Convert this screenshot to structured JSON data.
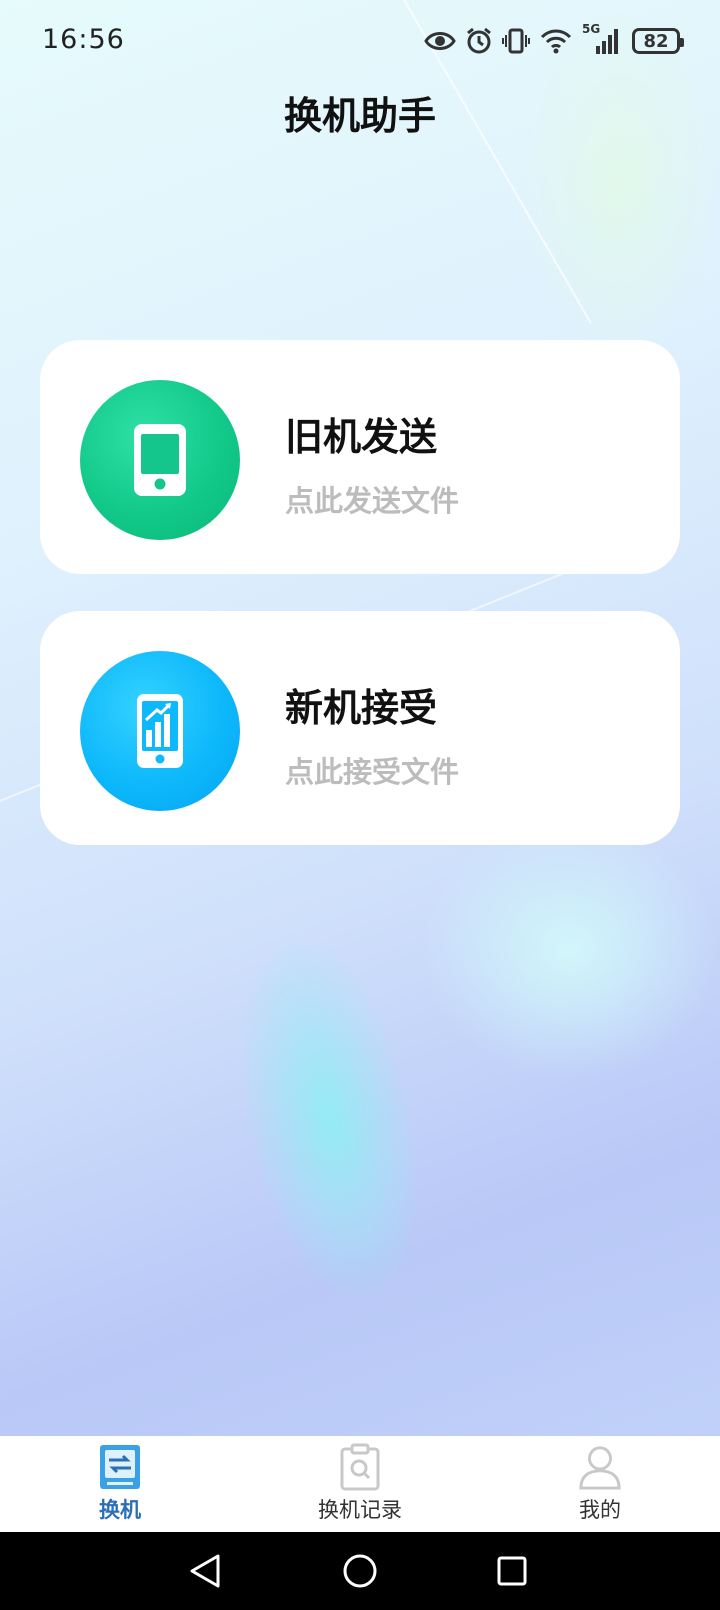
{
  "status_bar": {
    "time": "16:56",
    "network": "5G",
    "battery": "82",
    "icons": [
      "eye-icon",
      "alarm-icon",
      "vibrate-icon",
      "wifi-icon",
      "signal-icon",
      "battery-icon"
    ]
  },
  "header": {
    "title": "换机助手"
  },
  "cards": {
    "send": {
      "title": "旧机发送",
      "subtitle": "点此发送文件",
      "icon": "phone-icon",
      "color": "#12c98a"
    },
    "receive": {
      "title": "新机接受",
      "subtitle": "点此接受文件",
      "icon": "phone-chart-icon",
      "color": "#0db8fb"
    }
  },
  "tabbar": {
    "items": [
      {
        "label": "换机",
        "icon": "switch-icon",
        "active": true
      },
      {
        "label": "换机记录",
        "icon": "clipboard-search-icon",
        "active": false
      },
      {
        "label": "我的",
        "icon": "user-icon",
        "active": false
      }
    ],
    "active_color": "#2b6fb6"
  },
  "system_nav": {
    "icons": [
      "back-icon",
      "home-icon",
      "recent-apps-icon"
    ]
  }
}
